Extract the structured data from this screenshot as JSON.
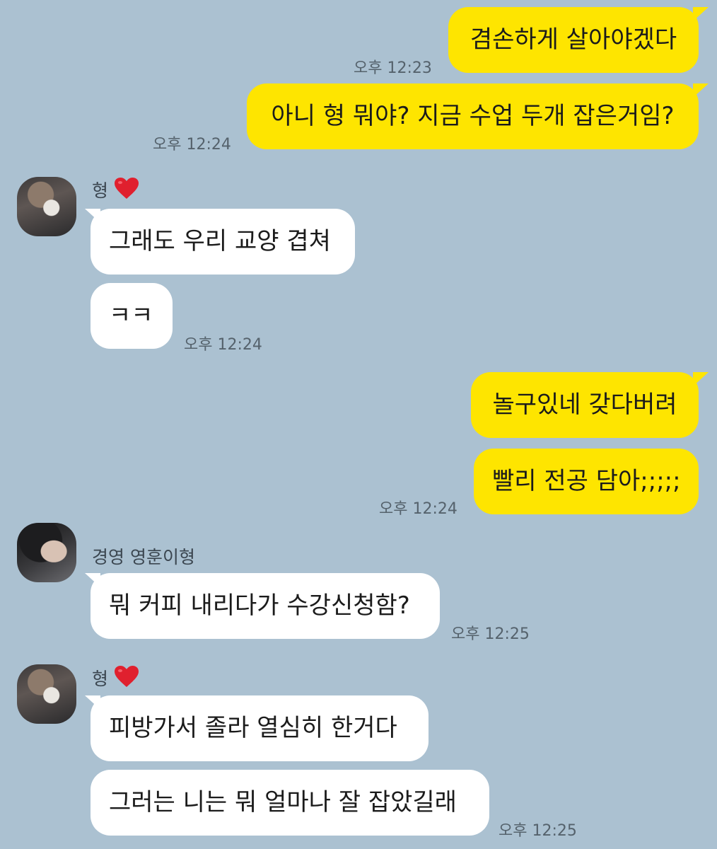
{
  "colors": {
    "background": "#abc1d1",
    "my_bubble": "#fee500",
    "other_bubble": "#ffffff",
    "heart": "#e0202e"
  },
  "messages": {
    "m1": {
      "text": "겸손하게 살아야겠다"
    },
    "m2": {
      "text": "아니 형 뭐야? 지금 수업 두개 잡은거임?"
    },
    "t1": "오후 12:23",
    "t2": "오후 12:24",
    "g1_sender": "형",
    "m3": {
      "text": "그래도 우리 교양 겹쳐"
    },
    "m4": {
      "text": "ㅋㅋ"
    },
    "t3": "오후 12:24",
    "m5": {
      "text": "놀구있네 갖다버려"
    },
    "m6": {
      "text": "빨리 전공 담아;;;;;"
    },
    "t4": "오후 12:24",
    "g2_sender": "경영 영훈이형",
    "m7": {
      "text": "뭐 커피 내리다가 수강신청함?"
    },
    "t5": "오후 12:25",
    "g3_sender": "형",
    "m8": {
      "text": "피방가서 졸라 열심히 한거다"
    },
    "m9": {
      "text": "그러는 니는 뭐 얼마나 잘 잡았길래"
    },
    "t6": "오후 12:25"
  },
  "icons": {
    "sender_heart": "heart-icon"
  }
}
